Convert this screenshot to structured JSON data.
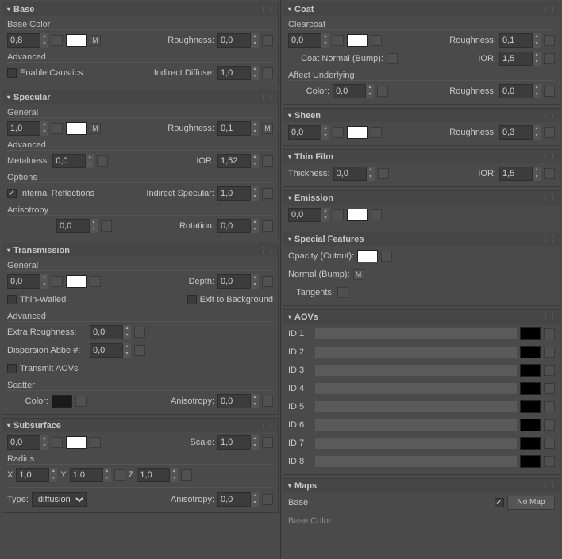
{
  "icons": {
    "tri": "▾",
    "dots": "⋮⋮",
    "up": "▴",
    "dn": "▾"
  },
  "base": {
    "title": "Base",
    "baseColor_lbl": "Base Color",
    "base_weight": "0,8",
    "roughness_lbl": "Roughness:",
    "roughness_val": "0,0",
    "advanced_lbl": "Advanced",
    "caustics_lbl": "Enable Caustics",
    "indirectDiffuse_lbl": "Indirect Diffuse:",
    "indirectDiffuse_val": "1,0"
  },
  "specular": {
    "title": "Specular",
    "general_lbl": "General",
    "weight": "1,0",
    "roughness_lbl": "Roughness:",
    "roughness_val": "0,1",
    "advanced_lbl": "Advanced",
    "metalness_lbl": "Metalness:",
    "metalness_val": "0,0",
    "ior_lbl": "IOR:",
    "ior_val": "1,52",
    "options_lbl": "Options",
    "intRefl_lbl": "Internal Reflections",
    "indirectSpec_lbl": "Indirect Specular:",
    "indirectSpec_val": "1,0",
    "anisotropy_lbl": "Anisotropy",
    "aniso_val": "0,0",
    "rotation_lbl": "Rotation:",
    "rotation_val": "0,0"
  },
  "transmission": {
    "title": "Transmission",
    "general_lbl": "General",
    "weight": "0,0",
    "depth_lbl": "Depth:",
    "depth_val": "0,0",
    "thin_lbl": "Thin-Walled",
    "exit_lbl": "Exit to Background",
    "advanced_lbl": "Advanced",
    "extraRough_lbl": "Extra Roughness:",
    "extraRough_val": "0,0",
    "abbe_lbl": "Dispersion Abbe #:",
    "abbe_val": "0,0",
    "transmitAOV_lbl": "Transmit AOVs",
    "scatter_lbl": "Scatter",
    "color_lbl": "Color:",
    "aniso_lbl": "Anisotropy:",
    "aniso_val": "0,0"
  },
  "sss": {
    "title": "Subsurface",
    "weight": "0,0",
    "scale_lbl": "Scale:",
    "scale_val": "1,0",
    "radius_lbl": "Radius",
    "x_lbl": "X",
    "x_val": "1,0",
    "y_lbl": "Y",
    "y_val": "1,0",
    "z_lbl": "Z",
    "z_val": "1,0",
    "type_lbl": "Type:",
    "type_val": "diffusion",
    "aniso_lbl": "Anisotropy:",
    "aniso_val": "0,0"
  },
  "coat": {
    "title": "Coat",
    "clearcoat_lbl": "Clearcoat",
    "weight": "0,0",
    "roughness_lbl": "Roughness:",
    "roughness_val": "0,1",
    "normal_lbl": "Coat Normal (Bump):",
    "ior_lbl": "IOR:",
    "ior_val": "1,5",
    "affect_lbl": "Affect Underlying",
    "color_lbl": "Color:",
    "color_val": "0,0",
    "rough2_lbl": "Roughness:",
    "rough2_val": "0,0"
  },
  "sheen": {
    "title": "Sheen",
    "weight": "0,0",
    "roughness_lbl": "Roughness:",
    "roughness_val": "0,3"
  },
  "thinfilm": {
    "title": "Thin Film",
    "thickness_lbl": "Thickness:",
    "thickness_val": "0,0",
    "ior_lbl": "IOR:",
    "ior_val": "1,5"
  },
  "emission": {
    "title": "Emission",
    "weight": "0,0"
  },
  "special": {
    "title": "Special Features",
    "opacity_lbl": "Opacity (Cutout):",
    "normal_lbl": "Normal (Bump):",
    "normal_m": "M",
    "tangents_lbl": "Tangents:"
  },
  "aovs": {
    "title": "AOVs",
    "labels": [
      "ID 1",
      "ID 2",
      "ID 3",
      "ID 4",
      "ID 5",
      "ID 6",
      "ID 7",
      "ID 8"
    ]
  },
  "maps": {
    "title": "Maps",
    "base_lbl": "Base",
    "basecolor_lbl": "Base Color",
    "nomap": "No Map"
  },
  "m_letter": "M"
}
